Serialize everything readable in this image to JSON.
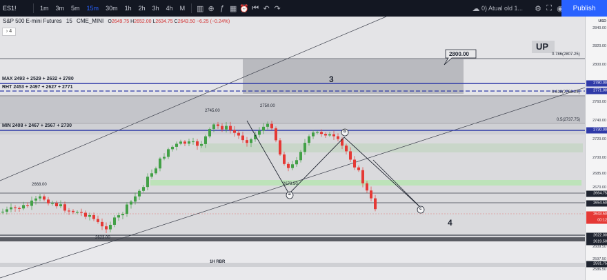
{
  "topbar": {
    "symbol": "ES1!",
    "timeframes": [
      "1m",
      "3m",
      "5m",
      "15m",
      "30m",
      "1h",
      "2h",
      "3h",
      "4h",
      "M"
    ],
    "active_timeframe": "15m",
    "layout_label": "0) Atual old 1...",
    "publish_label": "Publish",
    "icons": [
      "bar-style-icon",
      "compare-icon",
      "indicators-icon",
      "alert-icon",
      "replay-icon",
      "undo-icon",
      "redo-icon",
      "cloud-icon",
      "settings-icon",
      "fullscreen-icon",
      "camera-icon"
    ]
  },
  "legend": {
    "title": "S&P 500 E-mini Futures",
    "interval": "15",
    "exchange": "CME_MINI",
    "o_label": "O",
    "o": "2649.75",
    "h_label": "H",
    "h": "2652.00",
    "l_label": "L",
    "l": "2634.75",
    "c_label": "C",
    "c": "2643.50",
    "change": "−6.25 (−0.24%)",
    "collapse_label": "4"
  },
  "annotations": {
    "max_line": "MAX 2493 + 2529 + 2632 + 2780",
    "rht_line": "RHT 2453 + 2497 + 2627 + 2771",
    "min_line": "MIN  2408 + 2467 + 2567 + 2730",
    "up_label": "UP",
    "callout_2800": "2800.00",
    "fib_786": "0.786(2807.25)",
    "fib_618": "0.618(2766.25)",
    "fib_05": "0.5(2737.75)",
    "wave_3": "3",
    "wave_4": "4",
    "wave_a": "a",
    "wave_b": "b",
    "wave_c": "c",
    "label_2745": "2745.00",
    "label_2750": "2750.00",
    "label_2668": "2668.00",
    "label_2678": "2678.50",
    "label_2623": "2623.00",
    "rbr_label": "1H RBR"
  },
  "price_axis": {
    "currency": "USD",
    "ticks": [
      "2840.00",
      "2820.00",
      "2800.00",
      "2760.00",
      "2740.00",
      "2720.00",
      "2700.00",
      "2685.00",
      "2670.00",
      "2609.50",
      "2597.50",
      "2586.50"
    ],
    "tags": [
      {
        "text": "2780.00",
        "color": "#2f3aa8"
      },
      {
        "text": "2771.00",
        "color": "#2f3aa8"
      },
      {
        "text": "2730.00",
        "color": "#2f3aa8"
      },
      {
        "text": "2664.75",
        "color": "#1f2430"
      },
      {
        "text": "2654.50",
        "color": "#1f2430"
      },
      {
        "text": "2643.50",
        "color": "#e53935"
      },
      {
        "text": "00:12",
        "color": "#e53935"
      },
      {
        "text": "2622.00",
        "color": "#1f2430"
      },
      {
        "text": "2619.50",
        "color": "#1f2430"
      },
      {
        "text": "2591.75",
        "color": "#1f2430"
      }
    ]
  },
  "colors": {
    "up": "#43a047",
    "down": "#e53935",
    "channel_band": "#b7b8bd",
    "level_blue": "#2f3aa8"
  }
}
